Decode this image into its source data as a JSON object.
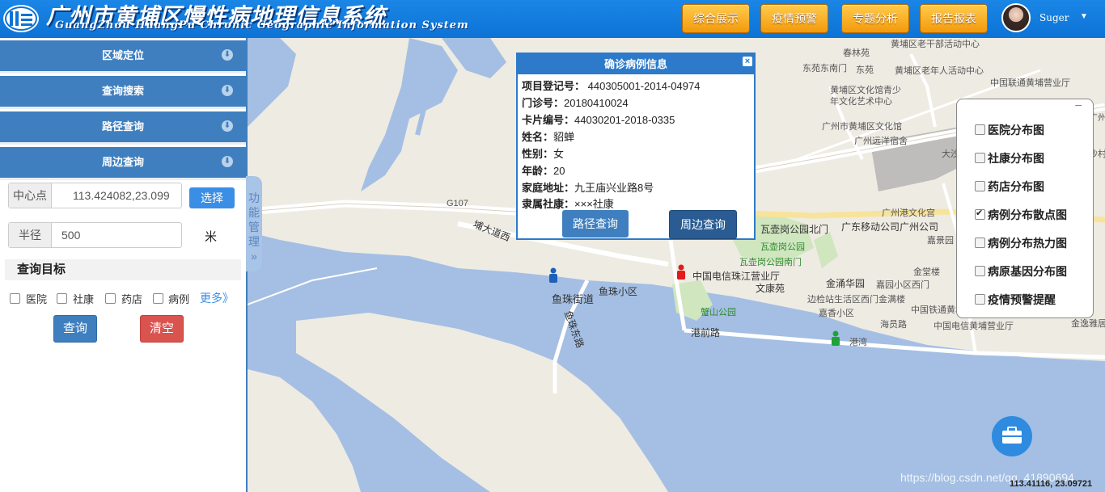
{
  "header": {
    "title": "广州市黄埔区慢性病地理信息系统",
    "subtitle": "GuangZhou HuangPu Chronic Geographic Information System",
    "nav": [
      "综合展示",
      "疫情预警",
      "专题分析",
      "报告报表"
    ],
    "username": "Suger"
  },
  "sidebar": {
    "sections": [
      "区域定位",
      "查询搜索",
      "路径查询",
      "周边查询"
    ],
    "center": {
      "label": "中心点",
      "value": "113.424082,23.099",
      "select_label": "选择"
    },
    "radius": {
      "label": "半径",
      "value": "500",
      "unit": "米"
    },
    "query_target": "查询目标",
    "targets": [
      "医院",
      "社康",
      "药店",
      "病例"
    ],
    "more": "更多》",
    "query_button": "查询",
    "clear_button": "清空",
    "side_tab": "功能管理 »"
  },
  "popup": {
    "title": "确诊病例信息",
    "fields": [
      {
        "label": "项目登记号：",
        "value": "440305001-2014-04974"
      },
      {
        "label": "门诊号：",
        "value": "20180410024"
      },
      {
        "label": "卡片编号：",
        "value": "44030201-2018-0335"
      },
      {
        "label": "姓名：",
        "value": "貂蝉"
      },
      {
        "label": "性别：",
        "value": "女"
      },
      {
        "label": "年龄：",
        "value": "20"
      },
      {
        "label": "家庭地址：",
        "value": "九王庙兴业路8号"
      },
      {
        "label": "隶属社康：",
        "value": "×××社康"
      }
    ],
    "route_button": "路径查询",
    "nearby_button": "周边查询"
  },
  "layers": {
    "collapse": "–",
    "items": [
      {
        "label": "医院分布图",
        "checked": false
      },
      {
        "label": "社康分布图",
        "checked": false
      },
      {
        "label": "药店分布图",
        "checked": false
      },
      {
        "label": "病例分布散点图",
        "checked": true
      },
      {
        "label": "病例分布热力图",
        "checked": false
      },
      {
        "label": "病原基因分布图",
        "checked": false
      },
      {
        "label": "疫情预警提醒",
        "checked": false
      }
    ]
  },
  "map": {
    "labels": [
      "黄埔区老干部活动中心",
      "东苑东南门",
      "东苑",
      "黄埔区老年人活动中心",
      "黄埔区文化馆青少",
      "年文化艺术中心",
      "中国联通黄埔营业厅",
      "广州市黄埔区文化馆",
      "广州远洋宿舍",
      "大沙东",
      "广州港文化宫",
      "瓦壶岗公园北门",
      "瓦壶岗公园",
      "瓦壶岗公园南门",
      "广东移动公司广州公司",
      "嘉景园",
      "中国电信珠江营业厅",
      "鱼珠小区",
      "鱼珠街道",
      "文康苑",
      "金涌华园",
      "金堂楼",
      "嘉园小区西门",
      "边检站生活区西门",
      "嘉香小区",
      "金满楼",
      "蟹山公园",
      "中国铁通黄埔营业厅",
      "海员路",
      "中国电信黄埔营业厅",
      "港前路",
      "G107",
      "埔大道西",
      "鱼珠东路",
      "金逸雅居",
      "春林苑",
      "港湾",
      "沙村",
      "广州"
    ],
    "coords": "113.41116, 23.09721",
    "watermark": "https://blog.csdn.net/qq_41890694"
  },
  "colors": {
    "header": "#0d73d6",
    "nav": "#f39a0b",
    "accordion": "#3f7fbf",
    "primary": "#2c7ac9",
    "danger": "#d9534f"
  }
}
